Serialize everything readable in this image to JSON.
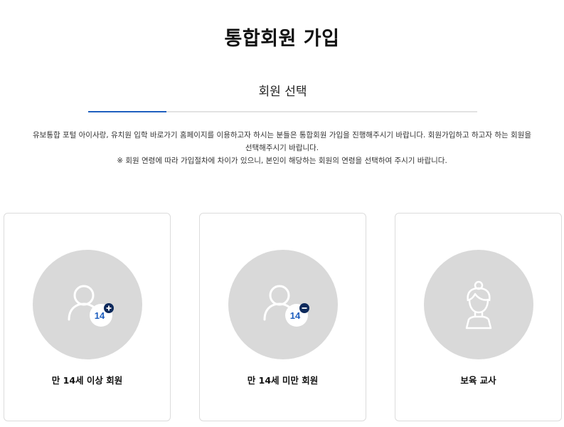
{
  "page": {
    "title": "통합회원 가입"
  },
  "step": {
    "label": "회원 선택"
  },
  "description": {
    "line1": "유보통합 포털 아이사랑, 유치원 입학 바로가기 홈페이지를 이용하고자 하시는 분들은 통합회원 가입을 진행해주시기 바랍니다. 회원가입하고 하고자 하는 회원을",
    "line2": "선택해주시기 바랍니다.",
    "line3": "※ 회원 연령에 따라 가입절차에 차이가 있으니, 본인이 해당하는 회원의 연령을 선택하여 주시기 바랍니다."
  },
  "cards": [
    {
      "label": "만 14세 이상 회원",
      "icon": "user-14-plus-icon",
      "badge_text": "14"
    },
    {
      "label": "만 14세 미만 회원",
      "icon": "user-14-minus-icon",
      "badge_text": "14"
    },
    {
      "label": "보육 교사",
      "icon": "teacher-icon"
    }
  ],
  "colors": {
    "accent": "#1f5fbf",
    "badge_dark": "#0d2a5c",
    "badge_text": "#1f5fbf",
    "circle": "#d9d9d9"
  }
}
